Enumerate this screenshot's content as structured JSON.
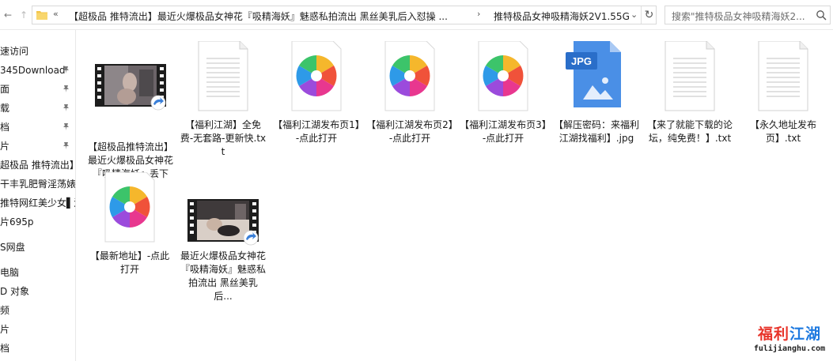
{
  "address_bar": {
    "overflow": "«",
    "crumbs": [
      "【超极品 推特流出】最近火爆极品女神花『吸精海妖』魅惑私拍流出 黑丝美乳后入怼操 ...",
      "推特极品女神吸精海妖2V1.55G"
    ],
    "separator": "›",
    "dropdown": "⌄",
    "refresh": "↻"
  },
  "search": {
    "placeholder": "搜索\"推特极品女神吸精海妖2..."
  },
  "nav": {
    "back": "←",
    "forward": "→",
    "up": "↑"
  },
  "sidebar": {
    "items": [
      {
        "label": "速访问",
        "pinned": false
      },
      {
        "label": "345Download",
        "pinned": true
      },
      {
        "label": "面",
        "pinned": true
      },
      {
        "label": "载",
        "pinned": true
      },
      {
        "label": "档",
        "pinned": true
      },
      {
        "label": "片",
        "pinned": true
      },
      {
        "label": "超极品 推特流出】",
        "pinned": false
      },
      {
        "label": "干丰乳肥臀淫荡婊",
        "pinned": false
      },
      {
        "label": "推特网红美少女▌沐",
        "pinned": false
      },
      {
        "label": "片695p",
        "pinned": false
      },
      {
        "label": "S网盘",
        "pinned": false
      },
      {
        "label": "电脑",
        "pinned": false
      },
      {
        "label": "D 对象",
        "pinned": false
      },
      {
        "label": "频",
        "pinned": false
      },
      {
        "label": "片",
        "pinned": false
      },
      {
        "label": "档",
        "pinned": false
      }
    ]
  },
  "files": [
    {
      "label": "【超极品推特流出】最近火爆极品女神花『吸精海妖』丢下姐...",
      "icon": "video-thumbnail-icon"
    },
    {
      "label": "【福利江湖】全免费-无套路-更新快.txt",
      "icon": "text-file-icon"
    },
    {
      "label": "【福利江湖发布页1】-点此打开",
      "icon": "browser-shortcut-icon"
    },
    {
      "label": "【福利江湖发布页2】-点此打开",
      "icon": "browser-shortcut-icon"
    },
    {
      "label": "【福利江湖发布页3】-点此打开",
      "icon": "browser-shortcut-icon"
    },
    {
      "label": "【解压密码：来福利江湖找福利】.jpg",
      "icon": "jpg-file-icon",
      "badge": "JPG"
    },
    {
      "label": "【来了就能下载的论坛，纯免费！】.txt",
      "icon": "text-file-icon"
    },
    {
      "label": "【永久地址发布页】.txt",
      "icon": "text-file-icon"
    },
    {
      "label": "【最新地址】-点此打开",
      "icon": "browser-shortcut-icon"
    },
    {
      "label": "最近火爆极品女神花『吸精海妖』魅惑私拍流出 黑丝美乳后...",
      "icon": "video-thumbnail-icon"
    }
  ],
  "watermark": {
    "title_part1": "福利",
    "title_part2": "江湖",
    "url": "fulijianghu.com"
  },
  "colors": {
    "accent": "#1f7ae0",
    "folder": "#f3c54b",
    "jpg_blue": "#4a8fe6",
    "watermark_red": "#e8342a"
  }
}
